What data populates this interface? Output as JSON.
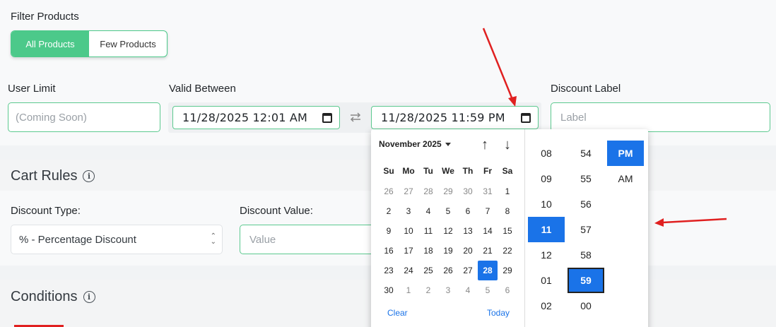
{
  "filter": {
    "title": "Filter Products",
    "options": [
      "All Products",
      "Few Products"
    ]
  },
  "user_limit": {
    "label": "User Limit",
    "placeholder": "(Coming Soon)"
  },
  "valid_between": {
    "label": "Valid Between",
    "start": "11/28/2025 12:01 AM",
    "end": "11/28/2025 11:59 PM"
  },
  "discount_label": {
    "label": "Discount Label",
    "placeholder": "Label"
  },
  "cart_rules": {
    "title": "Cart Rules",
    "discount_type_label": "Discount Type:",
    "discount_type_value": "% - Percentage Discount",
    "discount_value_label": "Discount Value:",
    "discount_value_placeholder": "Value"
  },
  "conditions": {
    "title": "Conditions"
  },
  "picker": {
    "month": "November 2025",
    "weekdays": [
      "Su",
      "Mo",
      "Tu",
      "We",
      "Th",
      "Fr",
      "Sa"
    ],
    "days": [
      [
        "26",
        "27",
        "28",
        "29",
        "30",
        "31",
        "1"
      ],
      [
        "2",
        "3",
        "4",
        "5",
        "6",
        "7",
        "8"
      ],
      [
        "9",
        "10",
        "11",
        "12",
        "13",
        "14",
        "15"
      ],
      [
        "16",
        "17",
        "18",
        "19",
        "20",
        "21",
        "22"
      ],
      [
        "23",
        "24",
        "25",
        "26",
        "27",
        "28",
        "29"
      ],
      [
        "30",
        "1",
        "2",
        "3",
        "4",
        "5",
        "6"
      ]
    ],
    "selected_day": "28",
    "clear": "Clear",
    "today": "Today",
    "hours": [
      "08",
      "09",
      "10",
      "11",
      "12",
      "01",
      "02"
    ],
    "selected_hour": "11",
    "minutes": [
      "54",
      "55",
      "56",
      "57",
      "58",
      "59",
      "00"
    ],
    "selected_minute": "59",
    "ampm": [
      "PM",
      "AM"
    ],
    "selected_ampm": "PM"
  },
  "colors": {
    "accent": "#4cc98a",
    "selected": "#1a73e8",
    "annotation": "#e02020"
  }
}
